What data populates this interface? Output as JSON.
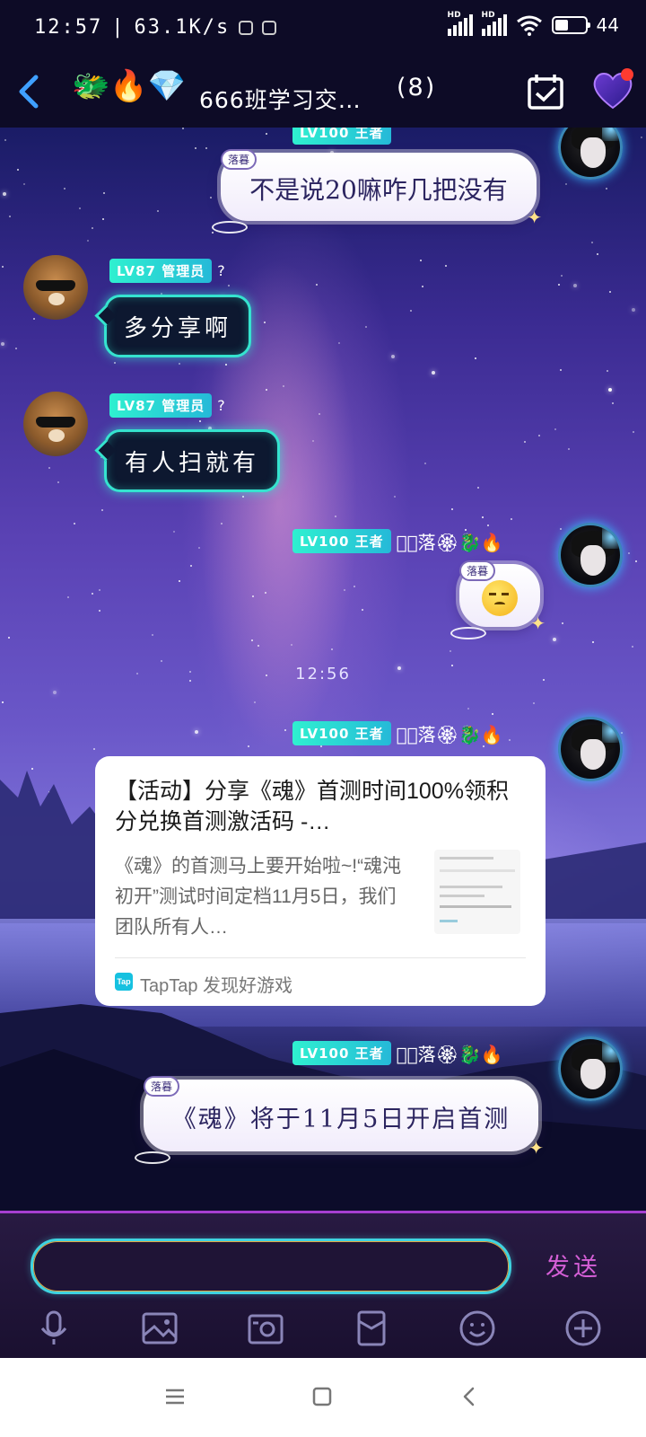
{
  "status_bar": {
    "time": "12:57",
    "separator": "|",
    "net_speed": "63.1K/s",
    "battery": "44",
    "battery_level": 0.44,
    "hd1": "HD",
    "hd2": "HD"
  },
  "header": {
    "title_emojis": "🐲🔥💎",
    "title": "666班学习交…",
    "member_count": "(8)",
    "back_icon": "chevron-left-icon",
    "calendar_icon": "calendar-check-icon",
    "heart_icon": "heart-icon"
  },
  "messages": [
    {
      "side": "right",
      "tag": "落暮",
      "text": "不是说20嘛咋几把没有"
    },
    {
      "side": "left",
      "badge": "LV87 管理员",
      "mark": "?",
      "text": "多分享啊"
    },
    {
      "side": "left",
      "badge": "LV87 管理员",
      "mark": "?",
      "text": "有人扫就有"
    },
    {
      "side": "right",
      "badge": "LV100 王者",
      "decor": "ᦔ⃝落🏵🐉🔥",
      "tag": "落暮",
      "emoji": "smirk-face"
    },
    {
      "side": "right",
      "badge": "LV100 王者",
      "decor": "ᦔ⃝落🏵🐉🔥",
      "type": "share-card"
    },
    {
      "side": "right",
      "badge": "LV100 王者",
      "decor": "ᦔ⃝落🏵🐉🔥",
      "tag": "落暮",
      "text": "《魂》将于11月5日开启首测"
    }
  ],
  "timestamp": "12:56",
  "share_card": {
    "title": "【活动】分享《魂》首测时间100%领积分兑换首测激活码 -…",
    "description": "《魂》的首测马上要开始啦~!“魂沌初开”测试时间定档11月5日，我们团队所有人…",
    "source_icon": "Tap",
    "source": "TapTap 发现好游戏"
  },
  "input": {
    "value": "",
    "placeholder": "",
    "send_label": "发送"
  },
  "toolbar": [
    "microphone-icon",
    "image-icon",
    "camera-icon",
    "red-packet-icon",
    "emoji-icon",
    "plus-icon"
  ],
  "nav": [
    "menu-icon",
    "home-square-icon",
    "back-icon"
  ]
}
